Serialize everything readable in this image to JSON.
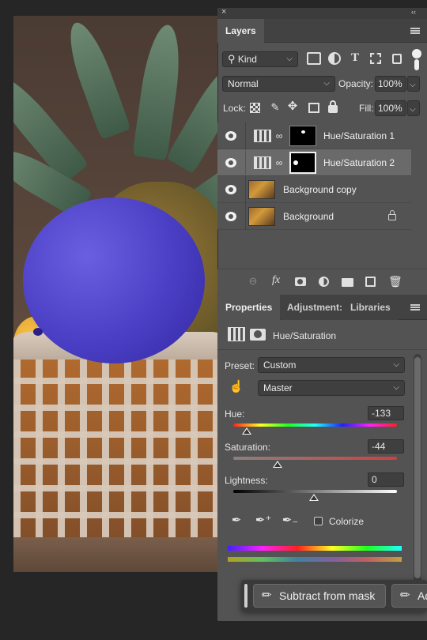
{
  "layers_panel": {
    "close_glyph": "×",
    "collapse_glyph": "‹‹",
    "tab_label": "Layers",
    "filter": {
      "kind_label": "Kind"
    },
    "blend_mode": "Normal",
    "opacity_label": "Opacity:",
    "opacity_value": "100%",
    "lock_label": "Lock:",
    "fill_label": "Fill:",
    "fill_value": "100%",
    "layers": [
      {
        "name": "Hue/Saturation 1",
        "type": "adjustment",
        "selected": false
      },
      {
        "name": "Hue/Saturation 2",
        "type": "adjustment",
        "selected": true
      },
      {
        "name": "Background copy",
        "type": "image",
        "selected": false
      },
      {
        "name": "Background",
        "type": "image",
        "locked": true,
        "selected": false
      }
    ],
    "bottom_icons": [
      "link-icon",
      "fx-icon",
      "add-mask-icon",
      "adjustment-icon",
      "folder-icon",
      "new-layer-icon",
      "trash-icon"
    ]
  },
  "properties_panel": {
    "tabs": [
      {
        "label": "Properties",
        "active": true
      },
      {
        "label": "Adjustment:",
        "active": false
      },
      {
        "label": "Libraries",
        "active": false
      }
    ],
    "adjustment_title": "Hue/Saturation",
    "preset_label": "Preset:",
    "preset_value": "Custom",
    "channel_value": "Master",
    "hue_label": "Hue:",
    "hue_value": "-133",
    "saturation_label": "Saturation:",
    "saturation_value": "-44",
    "lightness_label": "Lightness:",
    "lightness_value": "0",
    "colorize_label": "Colorize",
    "colorize_checked": false
  },
  "floating_bar": {
    "subtract_label": "Subtract from mask",
    "add_label": "Ad"
  },
  "colors": {
    "panel_bg": "#535353",
    "selected_row": "#6a6a6a",
    "recolored_fruit": "#4a3fc4"
  }
}
